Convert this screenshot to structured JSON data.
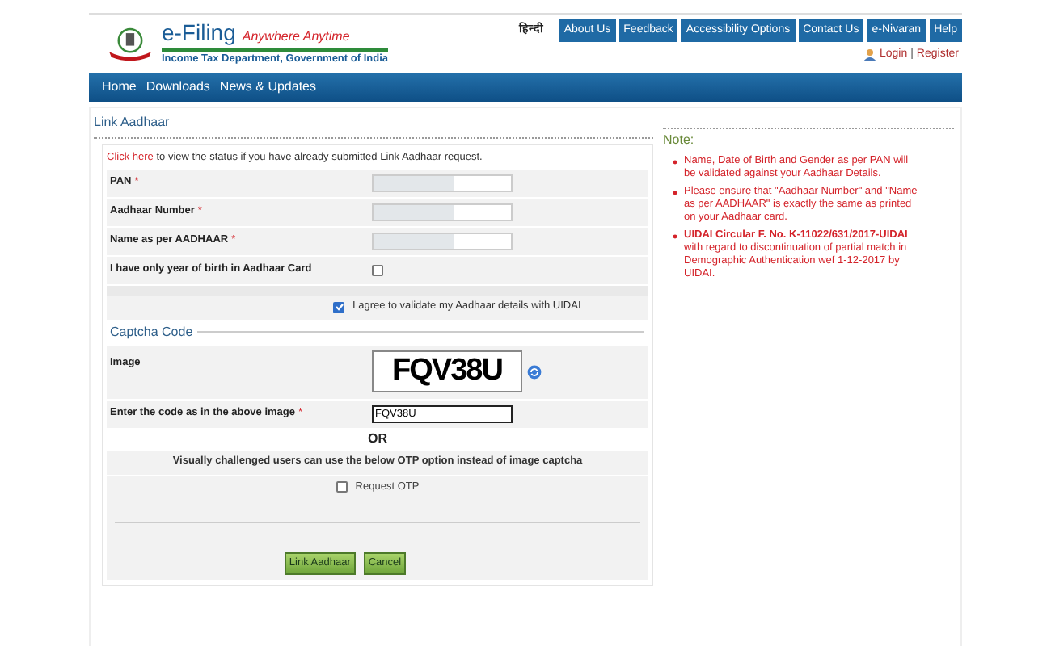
{
  "header": {
    "logo_title": "e-Filing",
    "logo_tagline": "Anywhere Anytime",
    "logo_subtitle": "Income Tax Department, Government of India",
    "language_link": "हिन्दी",
    "top_menu": [
      "About Us",
      "Feedback",
      "Accessibility Options",
      "Contact Us",
      "e-Nivaran",
      "Help"
    ],
    "login": "Login",
    "separator": "|",
    "register": "Register"
  },
  "nav": [
    "Home",
    "Downloads",
    "News & Updates"
  ],
  "form": {
    "title": "Link Aadhaar",
    "status_link": "Click here",
    "status_text": "to view the status if you have already submitted Link Aadhaar request.",
    "fields": [
      {
        "label": "PAN",
        "required_mark": "*",
        "kind": "text"
      },
      {
        "label": "Aadhaar Number",
        "required_mark": "*",
        "kind": "text"
      },
      {
        "label": "Name as per AADHAAR",
        "required_mark": "*",
        "kind": "text"
      },
      {
        "label": "I have only year of birth in Aadhaar Card",
        "kind": "checkbox",
        "checked": false
      }
    ],
    "agree": {
      "label": "I agree to validate my Aadhaar details with UIDAI",
      "checked": true
    },
    "captcha_section": "Captcha Code",
    "captcha_label": "Image",
    "captcha_text": "FQV38U",
    "code_label": "Enter the code as in the above image",
    "code_required_mark": "*",
    "code_value": "FQV38U",
    "or_text": "OR",
    "otp_hint": "Visually challenged users can use the below OTP option instead of image captcha",
    "otp": {
      "label": "Request OTP",
      "checked": false
    },
    "buttons": [
      "Link Aadhaar",
      "Cancel"
    ]
  },
  "note": {
    "title": "Note:",
    "items": [
      {
        "text": "Name, Date of Birth and Gender as per PAN will be validated against your Aadhaar Details."
      },
      {
        "text": "Please ensure that \"Aadhaar Number\" and \"Name as per AADHAAR\" is exactly the same as printed on your Aadhaar card."
      },
      {
        "text": "**UIDAI Circular F. No. K-11022/631/2017-UIDAI** with regard to discontinuation of partial match in Demographic Authentication wef 1-12-2017 by UIDAI."
      }
    ]
  }
}
